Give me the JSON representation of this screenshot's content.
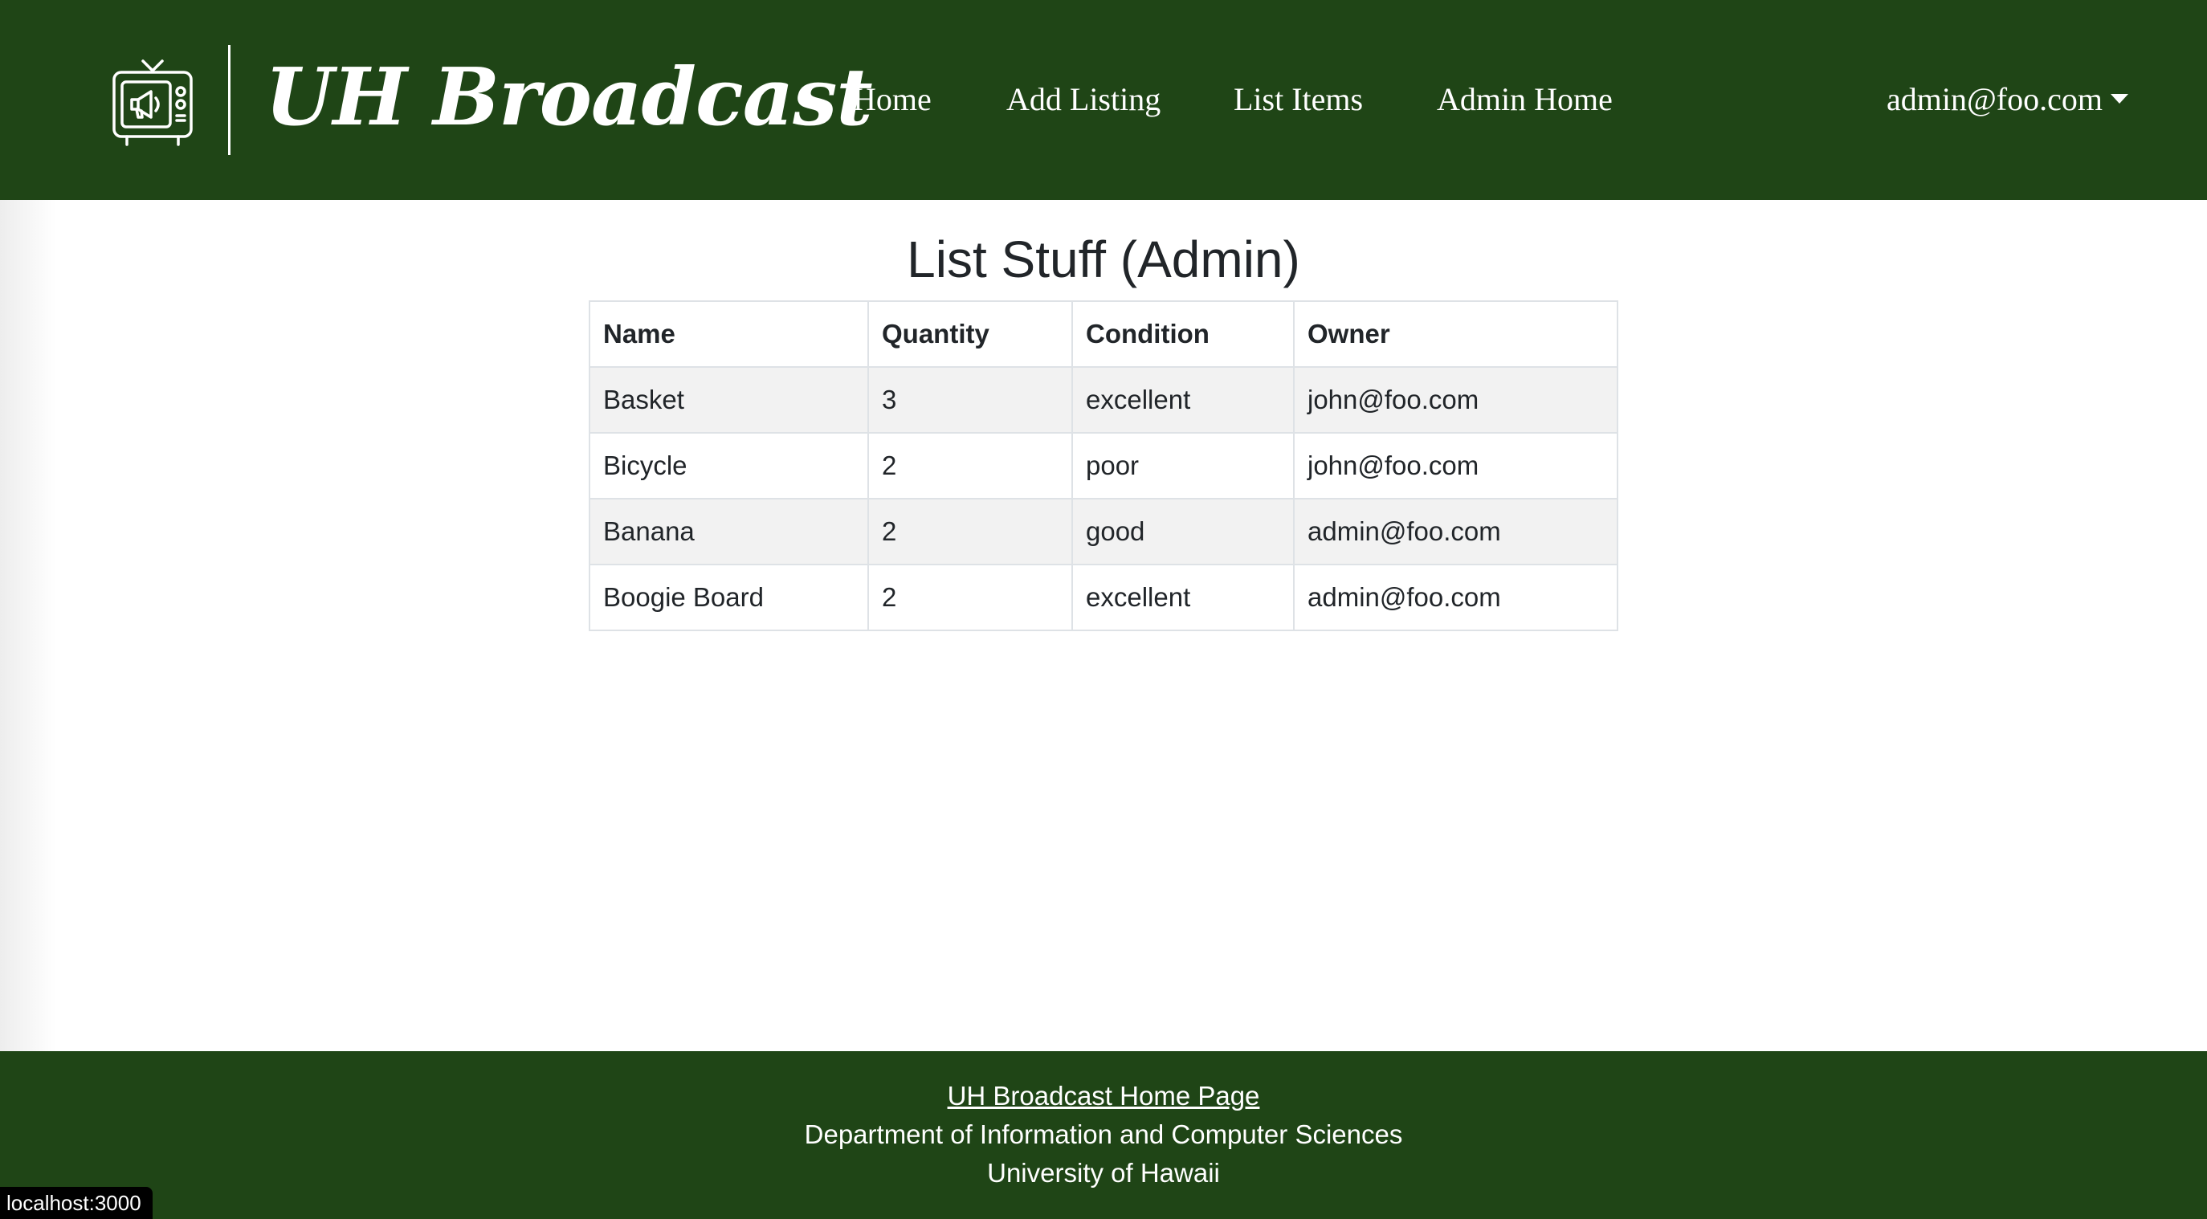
{
  "navbar": {
    "brand_title": "UH Broadcast",
    "brand_icon": "tv-megaphone-icon",
    "links": {
      "home": "Home",
      "add_listing": "Add Listing",
      "list_items": "List Items",
      "admin_home": "Admin Home"
    },
    "user_menu": "admin@foo.com"
  },
  "main": {
    "title": "List Stuff (Admin)",
    "table": {
      "headers": [
        "Name",
        "Quantity",
        "Condition",
        "Owner"
      ],
      "rows": [
        [
          "Basket",
          "3",
          "excellent",
          "john@foo.com"
        ],
        [
          "Bicycle",
          "2",
          "poor",
          "john@foo.com"
        ],
        [
          "Banana",
          "2",
          "good",
          "admin@foo.com"
        ],
        [
          "Boogie Board",
          "2",
          "excellent",
          "admin@foo.com"
        ]
      ]
    }
  },
  "footer": {
    "link_text": "UH Broadcast Home Page",
    "department": "Department of Information and Computer Sciences",
    "university": "University of Hawaii"
  },
  "status_bar": {
    "url": "localhost:3000"
  },
  "colors": {
    "brand_green": "#1f4516",
    "table_stripe": "#f2f2f2",
    "text": "#212529"
  }
}
